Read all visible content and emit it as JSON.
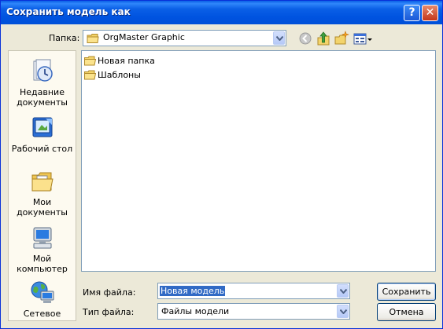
{
  "window": {
    "title": "Сохранить модель как"
  },
  "titlebar_buttons": {
    "help": "?",
    "close": "✕"
  },
  "lookin": {
    "label": "Папка:",
    "value": "OrgMaster Graphic"
  },
  "toolbar": {
    "icons": [
      "back-icon",
      "up-folder-icon",
      "new-folder-icon",
      "view-menu-icon"
    ]
  },
  "places": [
    {
      "label": "Недавние документы",
      "icon": "recent-documents-icon"
    },
    {
      "label": "Рабочий стол",
      "icon": "desktop-icon"
    },
    {
      "label": "Мои документы",
      "icon": "my-documents-icon"
    },
    {
      "label": "Мой компьютер",
      "icon": "my-computer-icon"
    },
    {
      "label": "Сетевое",
      "icon": "network-icon"
    }
  ],
  "files": [
    {
      "name": "Новая папка",
      "icon": "folder-icon"
    },
    {
      "name": "Шаблоны",
      "icon": "folder-icon"
    }
  ],
  "filename": {
    "label": "Имя файла:",
    "value": "Новая модель"
  },
  "filetype": {
    "label": "Тип файла:",
    "value": "Файлы модели"
  },
  "buttons": {
    "save": "Сохранить",
    "cancel": "Отмена"
  },
  "colors": {
    "titlebar": "#0a5fe6",
    "dialog_bg": "#ece9d8",
    "places_bg": "#fdfaf0",
    "selection": "#316ac5"
  }
}
